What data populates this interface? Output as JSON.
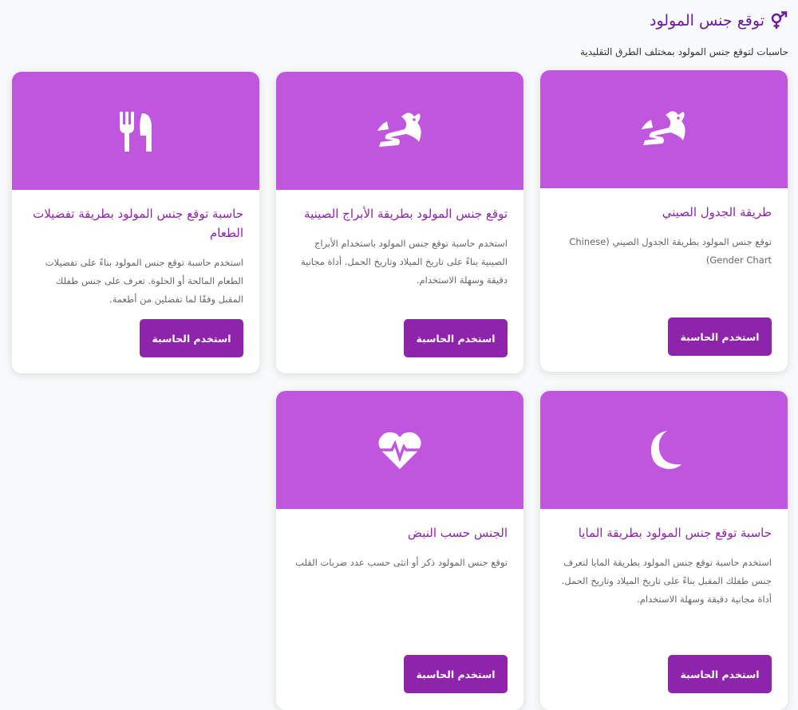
{
  "header": {
    "title": "توقع جنس المولود",
    "subtitle": "حاسبات لتوقع جنس المولود بمختلف الطرق التقليدية"
  },
  "colors": {
    "banner": "#c056de",
    "accent": "#8e24aa",
    "title": "#6a1b9a"
  },
  "cards": [
    {
      "icon": "dragon-icon",
      "title": "طريقة الجدول الصيني",
      "description": "توقع جنس المولود بطريقة الجدول الصيني (Chinese Gender Chart)",
      "button": "استخدم الحاسبة"
    },
    {
      "icon": "dragon-icon",
      "title": "توقع جنس المولود بطريقة الأبراج الصينية",
      "description": "استخدم حاسبة توقع جنس المولود باستخدام الأبراج الصينية بناءً على تاريخ الميلاد وتاريخ الحمل. أداة مجانية دقيقة وسهلة الاستخدام.",
      "button": "استخدم الحاسبة"
    },
    {
      "icon": "utensils-icon",
      "title": "حاسبة توقع جنس المولود بطريقة تفضيلات الطعام",
      "description": "استخدم حاسبة توقع جنس المولود بناءً على تفضيلات الطعام المالحة أو الحلوة. تعرف على جنس طفلك المقبل وفقًا لما تفضلين من أطعمة.",
      "button": "استخدم الحاسبة"
    },
    {
      "icon": "moon-icon",
      "title": "حاسبة توقع جنس المولود بطريقة المايا",
      "description": "استخدم حاسبة توقع جنس المولود بطريقة المايا لتعرف جنس طفلك المقبل بناءً على تاريخ الميلاد وتاريخ الحمل. أداة مجانية دقيقة وسهلة الاستخدام.",
      "button": "استخدم الحاسبة"
    },
    {
      "icon": "heartbeat-icon",
      "title": "الجنس حسب النبض",
      "description": "توقع جنس المولود ذكر أو انثى حسب عدد ضربات القلب",
      "button": "استخدم الحاسبة"
    }
  ]
}
